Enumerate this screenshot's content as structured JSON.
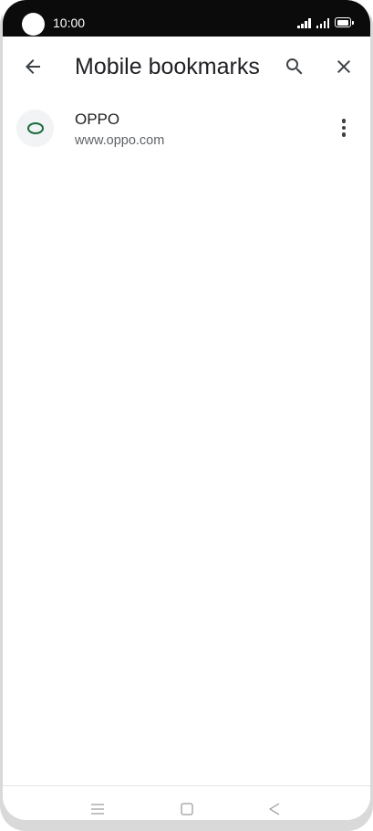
{
  "status_bar": {
    "time": "10:00"
  },
  "toolbar": {
    "title": "Mobile bookmarks",
    "back_icon": "arrow-back-icon",
    "search_icon": "search-icon",
    "close_icon": "close-icon"
  },
  "bookmarks": [
    {
      "title": "OPPO",
      "url": "www.oppo.com",
      "favicon_icon": "oppo-favicon-icon",
      "more_icon": "more-vert-icon"
    }
  ],
  "nav_bar": {
    "menu_icon": "menu-icon",
    "home_icon": "home-square-icon",
    "back_icon": "back-triangle-icon"
  },
  "colors": {
    "status_bar_bg": "#0b0b0b",
    "favicon_ring": "#1a6b3c",
    "favicon_bg": "#f1f3f4",
    "text_primary": "#202124",
    "text_secondary": "#5f6368"
  }
}
